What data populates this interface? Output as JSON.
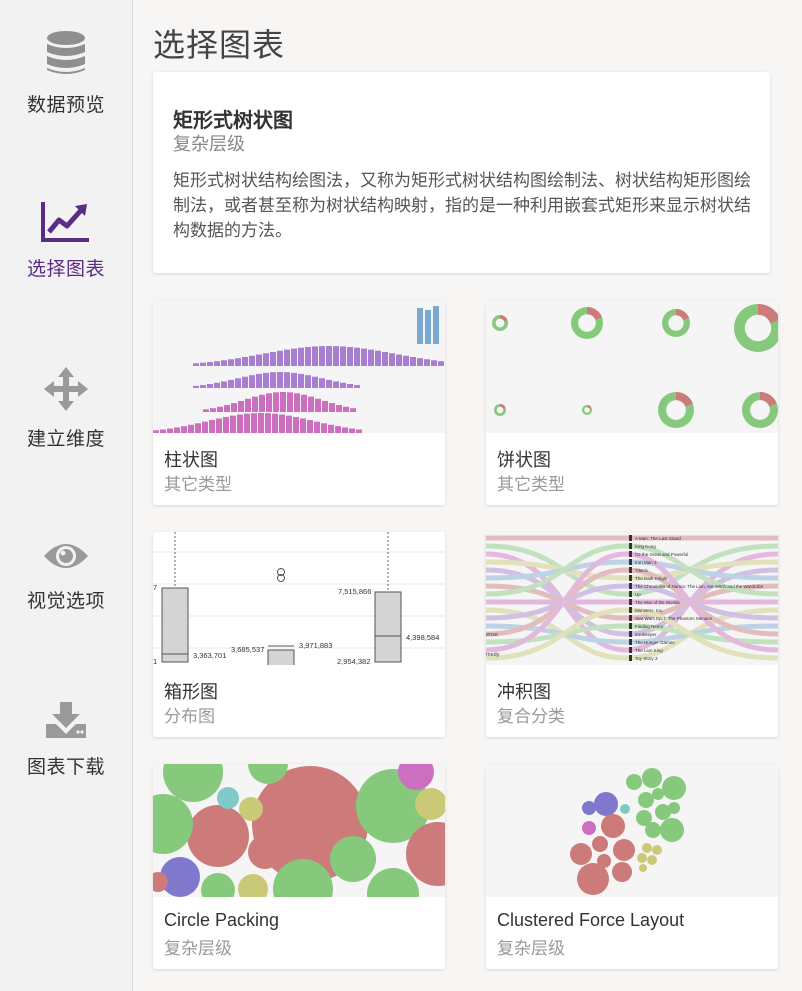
{
  "sidebar": {
    "items": [
      {
        "label": "数据预览",
        "icon": "database-icon"
      },
      {
        "label": "选择图表",
        "icon": "line-chart-icon",
        "active": true
      },
      {
        "label": "建立维度",
        "icon": "move-arrows-icon"
      },
      {
        "label": "视觉选项",
        "icon": "eye-icon"
      },
      {
        "label": "图表下载",
        "icon": "download-icon"
      }
    ]
  },
  "main": {
    "title": "选择图表",
    "selected": {
      "title": "矩形式树状图",
      "category": "复杂层级",
      "description": "矩形式树状结构绘图法，又称为矩形式树状结构图绘制法、树状结构矩形图绘制法，或者甚至称为树状结构映射，指的是一种利用嵌套式矩形来显示树状结构数据的方法。"
    },
    "charts": [
      {
        "title": "柱状图",
        "category": "其它类型"
      },
      {
        "title": "饼状图",
        "category": "其它类型"
      },
      {
        "title": "箱形图",
        "category": "分布图"
      },
      {
        "title": "冲积图",
        "category": "复合分类"
      },
      {
        "title": "Circle Packing",
        "category": "复杂层级"
      },
      {
        "title": "Clustered Force Layout",
        "category": "复杂层级"
      }
    ],
    "boxplot_labels": [
      "7,515,866",
      "4,398,584",
      "3,971,883",
      "3,685,537",
      "3,363,701",
      "2,954,382",
      "7",
      "1"
    ],
    "alluvial_labels": [
      "A Man: The Last Stand",
      "King Kong",
      "Oz the Great and Powerful",
      "Iron Man 3",
      "Titanic",
      "The Dark Knight",
      "The Chronicles of Narnia: The Lion, the Witch and the Wardrobe",
      "Up",
      "The War of the Worlds",
      "Monsters, Inc.",
      "Star Wars Ep. I: The Phantom Menace",
      "Finding Nemo",
      "Zookeeper",
      "The Hunger Games",
      "The Lion King",
      "Toy Story 3"
    ],
    "alluvial_left_labels": [
      "ense",
      "medy"
    ]
  },
  "colors": {
    "accent": "#5b2c86",
    "purple": "#a87ed1",
    "pink": "#cd6fc0",
    "blue": "#7ba8d0",
    "green": "#86c97d",
    "red": "#cc7a7a"
  }
}
